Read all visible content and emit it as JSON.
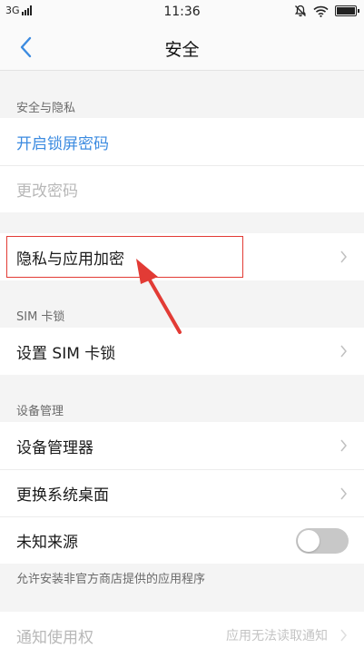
{
  "status_bar": {
    "network": "3G",
    "time": "11:36",
    "icons": [
      "signal-icon",
      "mute-icon",
      "wifi-icon",
      "battery-icon"
    ]
  },
  "nav": {
    "title": "安全",
    "back_icon": "chevron-left-icon"
  },
  "sections": {
    "security_privacy": {
      "label": "安全与隐私",
      "items": [
        {
          "label": "开启锁屏密码",
          "style": "link"
        },
        {
          "label": "更改密码",
          "style": "disabled"
        }
      ]
    },
    "privacy_app": {
      "items": [
        {
          "label": "隐私与应用加密",
          "icon": "chevron-right-icon"
        }
      ]
    },
    "sim_lock": {
      "label": "SIM 卡锁",
      "items": [
        {
          "label": "设置 SIM 卡锁",
          "icon": "chevron-right-icon"
        }
      ]
    },
    "device_management": {
      "label": "设备管理",
      "items": [
        {
          "label": "设备管理器",
          "icon": "chevron-right-icon"
        },
        {
          "label": "更换系统桌面",
          "icon": "chevron-right-icon"
        },
        {
          "label": "未知来源",
          "toggle": false
        }
      ],
      "footnote": "允许安装非官方商店提供的应用程序"
    },
    "notification_access": {
      "items": [
        {
          "label": "通知使用权",
          "value": "应用无法读取通知",
          "style": "disabled"
        }
      ]
    }
  },
  "annotation": {
    "box_color": "#e23b35",
    "arrow_color": "#e23b35"
  },
  "colors": {
    "accent": "#3c8be0",
    "background": "#f4f4f4",
    "disabled_text": "#b8b8b8",
    "toggle_off": "#c8c8c8"
  }
}
